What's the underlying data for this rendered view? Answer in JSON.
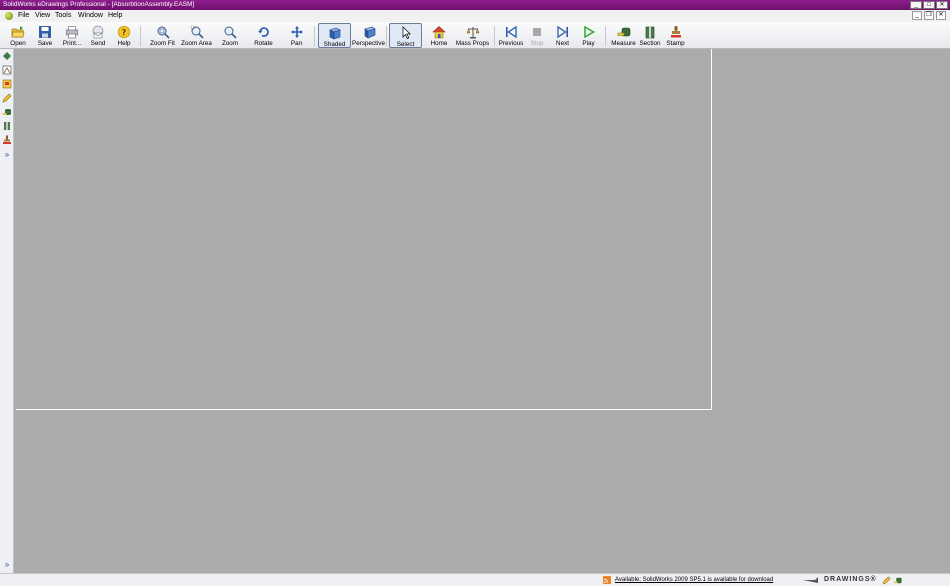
{
  "window": {
    "title": "SolidWorks eDrawings Professional - [AbsorbtionAssembly.EASM]",
    "minimize_symbol": "_",
    "maximize_symbol": "□",
    "close_symbol": "✕",
    "doc_minimize_symbol": "_",
    "doc_restore_symbol": "❐",
    "doc_close_symbol": "✕"
  },
  "menu": [
    "File",
    "View",
    "Tools",
    "Window",
    "Help"
  ],
  "toolbar": {
    "open": "Open",
    "save": "Save",
    "print": "Print...",
    "send": "Send",
    "help": "Help",
    "zoom_fit": "Zoom Fit",
    "zoom_area": "Zoom Area",
    "zoom": "Zoom",
    "rotate": "Rotate",
    "pan": "Pan",
    "shaded": "Shaded",
    "perspective": "Perspective",
    "select": "Select",
    "home": "Home",
    "mass_props": "Mass Props",
    "previous": "Previous",
    "stop": "Stop",
    "next": "Next",
    "play": "Play",
    "measure": "Measure",
    "section": "Section",
    "stamp": "Stamp"
  },
  "sidebar": {
    "expand_top": "»",
    "expand_bottom": "»"
  },
  "status": {
    "message": "Available: SolidWorks 2009 SP5.1 is available for download",
    "logo": "DRAWINGS®"
  },
  "colors": {
    "titlebar": "#7a157a",
    "viewport": "#ababab",
    "play_green": "#2ea82e",
    "nav_blue": "#2a5db0"
  }
}
